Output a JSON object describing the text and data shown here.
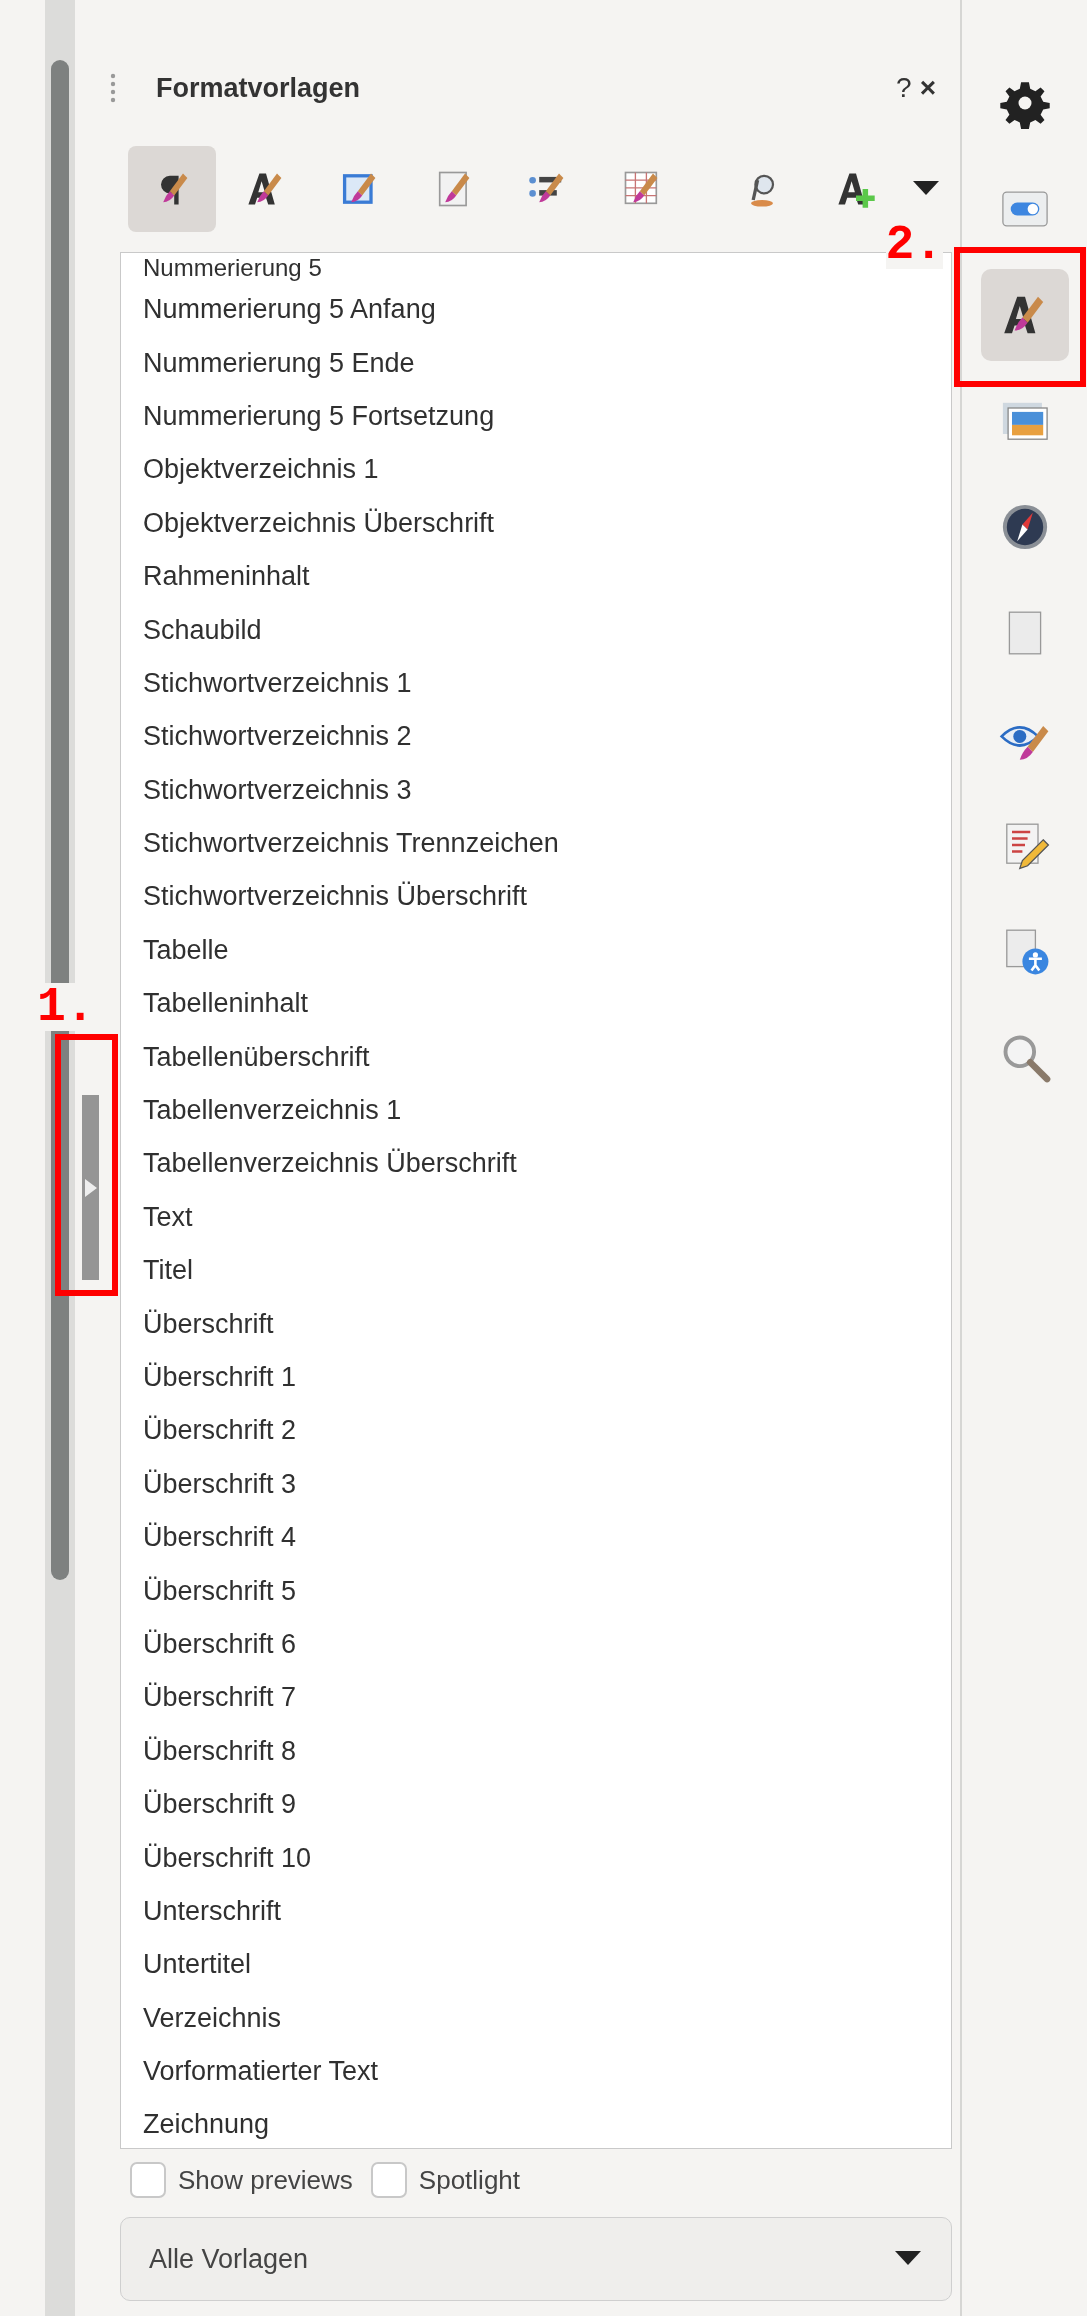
{
  "panel": {
    "title": "Formatvorlagen",
    "help": "?",
    "close": "×"
  },
  "toolbar": [
    {
      "kind": "paragraph",
      "selected": true
    },
    {
      "kind": "character",
      "selected": false
    },
    {
      "kind": "frame",
      "selected": false
    },
    {
      "kind": "page",
      "selected": false
    },
    {
      "kind": "list",
      "selected": false
    },
    {
      "kind": "table",
      "selected": false
    },
    {
      "kind": "fill",
      "selected": false
    },
    {
      "kind": "new",
      "selected": false
    }
  ],
  "styles": [
    "Nummerierung 5",
    "Nummerierung 5 Anfang",
    "Nummerierung 5 Ende",
    "Nummerierung 5 Fortsetzung",
    "Objektverzeichnis 1",
    "Objektverzeichnis Überschrift",
    "Rahmeninhalt",
    "Schaubild",
    "Stichwortverzeichnis 1",
    "Stichwortverzeichnis 2",
    "Stichwortverzeichnis 3",
    "Stichwortverzeichnis Trennzeichen",
    "Stichwortverzeichnis Überschrift",
    "Tabelle",
    "Tabelleninhalt",
    "Tabellenüberschrift",
    "Tabellenverzeichnis 1",
    "Tabellenverzeichnis Überschrift",
    "Text",
    "Titel",
    "Überschrift",
    "Überschrift 1",
    "Überschrift 2",
    "Überschrift 3",
    "Überschrift 4",
    "Überschrift 5",
    "Überschrift 6",
    "Überschrift 7",
    "Überschrift 8",
    "Überschrift 9",
    "Überschrift 10",
    "Unterschrift",
    "Untertitel",
    "Verzeichnis",
    "Vorformatierter Text",
    "Zeichnung"
  ],
  "options": [
    {
      "label": "Show previews",
      "checked": false
    },
    {
      "label": "Spotlight",
      "checked": false
    }
  ],
  "filter": {
    "value": "Alle Vorlagen"
  },
  "collapse_handle": {
    "annotation": "1."
  },
  "sidebar": [
    {
      "kind": "settings",
      "selected": false
    },
    {
      "kind": "properties",
      "selected": false
    },
    {
      "kind": "styles",
      "selected": true,
      "annotation": "2."
    },
    {
      "kind": "gallery",
      "selected": false
    },
    {
      "kind": "navigator",
      "selected": false
    },
    {
      "kind": "page",
      "selected": false
    },
    {
      "kind": "inspector",
      "selected": false
    },
    {
      "kind": "changes",
      "selected": false
    },
    {
      "kind": "accessibility",
      "selected": false
    },
    {
      "kind": "find",
      "selected": false
    }
  ]
}
